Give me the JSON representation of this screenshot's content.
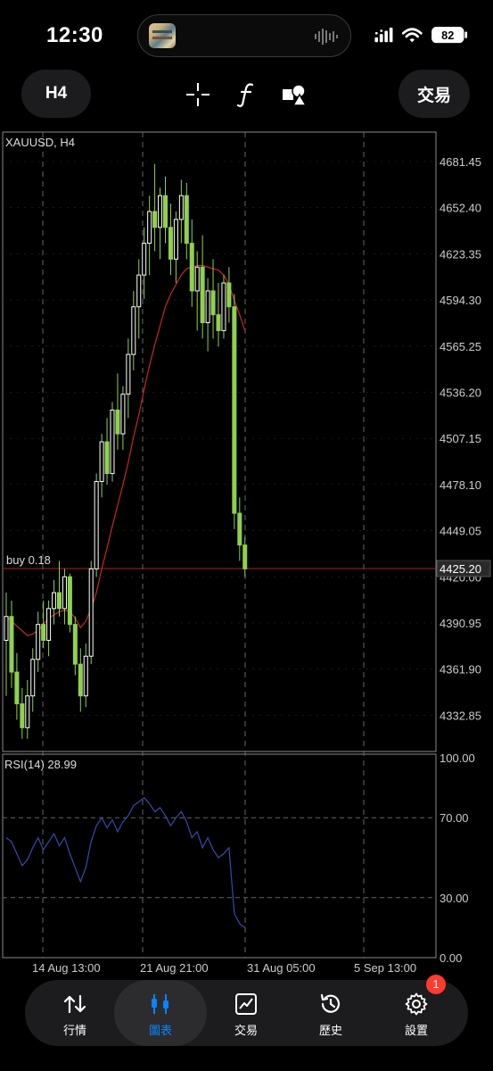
{
  "status_bar": {
    "time": "12:30",
    "battery": "82",
    "icons": [
      "signal-icon",
      "wifi-icon",
      "battery-icon"
    ]
  },
  "toolbar": {
    "timeframe_label": "H4",
    "language_label": "交易",
    "tools": [
      "crosshair-icon",
      "function-icon",
      "shapes-icon"
    ]
  },
  "chart": {
    "symbol_label": "XAUUSD, H4",
    "position_label": "buy 0.18",
    "current_price": "4425.20",
    "price_ticks": [
      "4681.45",
      "4652.40",
      "4623.35",
      "4594.30",
      "4565.25",
      "4536.20",
      "4507.15",
      "4478.10",
      "4449.05",
      "4420.00",
      "4390.95",
      "4361.90",
      "4332.85"
    ],
    "rsi_label": "RSI(14) 28.99",
    "rsi_ticks": [
      "100.00",
      "70.00",
      "30.00",
      "0.00"
    ],
    "date_ticks": [
      "14 Aug 13:00",
      "21 Aug 21:00",
      "31 Aug 05:00",
      "5 Sep 13:00"
    ],
    "colors": {
      "bull": "#ffffff",
      "bear": "#8fd14f",
      "ma": "#c62828",
      "rsi": "#3949ab",
      "price_line": "#b71c1c",
      "grid": "#666666"
    }
  },
  "chart_data": {
    "type": "candlestick",
    "title": "XAUUSD, H4",
    "ylim": [
      4310,
      4700
    ],
    "ohlc": [
      [
        4380,
        4410,
        4345,
        4395
      ],
      [
        4395,
        4405,
        4350,
        4360
      ],
      [
        4360,
        4372,
        4330,
        4340
      ],
      [
        4340,
        4350,
        4318,
        4325
      ],
      [
        4325,
        4355,
        4318,
        4345
      ],
      [
        4345,
        4375,
        4335,
        4368
      ],
      [
        4368,
        4398,
        4360,
        4390
      ],
      [
        4390,
        4405,
        4375,
        4380
      ],
      [
        4380,
        4405,
        4370,
        4400
      ],
      [
        4400,
        4418,
        4390,
        4410
      ],
      [
        4410,
        4430,
        4395,
        4400
      ],
      [
        4400,
        4425,
        4390,
        4420
      ],
      [
        4420,
        4422,
        4385,
        4390
      ],
      [
        4390,
        4395,
        4358,
        4365
      ],
      [
        4365,
        4375,
        4335,
        4345
      ],
      [
        4345,
        4378,
        4338,
        4370
      ],
      [
        4370,
        4430,
        4365,
        4425
      ],
      [
        4425,
        4485,
        4420,
        4480
      ],
      [
        4480,
        4510,
        4470,
        4505
      ],
      [
        4505,
        4520,
        4478,
        4485
      ],
      [
        4485,
        4530,
        4480,
        4525
      ],
      [
        4525,
        4548,
        4500,
        4510
      ],
      [
        4510,
        4540,
        4500,
        4535
      ],
      [
        4535,
        4570,
        4520,
        4560
      ],
      [
        4560,
        4600,
        4550,
        4590
      ],
      [
        4590,
        4620,
        4570,
        4610
      ],
      [
        4610,
        4640,
        4595,
        4630
      ],
      [
        4630,
        4660,
        4610,
        4650
      ],
      [
        4650,
        4680,
        4625,
        4640
      ],
      [
        4640,
        4665,
        4620,
        4660
      ],
      [
        4660,
        4672,
        4630,
        4640
      ],
      [
        4640,
        4655,
        4610,
        4620
      ],
      [
        4620,
        4650,
        4605,
        4645
      ],
      [
        4645,
        4670,
        4630,
        4660
      ],
      [
        4660,
        4668,
        4620,
        4630
      ],
      [
        4630,
        4645,
        4590,
        4600
      ],
      [
        4600,
        4625,
        4575,
        4615
      ],
      [
        4615,
        4635,
        4570,
        4580
      ],
      [
        4580,
        4608,
        4562,
        4600
      ],
      [
        4600,
        4620,
        4570,
        4585
      ],
      [
        4585,
        4605,
        4565,
        4575
      ],
      [
        4575,
        4610,
        4570,
        4605
      ],
      [
        4605,
        4615,
        4580,
        4590
      ],
      [
        4590,
        4598,
        4450,
        4460
      ],
      [
        4460,
        4470,
        4430,
        4440
      ],
      [
        4440,
        4445,
        4420,
        4425
      ]
    ],
    "ma": [
      4395,
      4392,
      4389,
      4386,
      4383,
      4384,
      4386,
      4390,
      4394,
      4396,
      4398,
      4399,
      4398,
      4394,
      4388,
      4392,
      4400,
      4410,
      4425,
      4438,
      4452,
      4465,
      4478,
      4492,
      4508,
      4522,
      4538,
      4553,
      4566,
      4578,
      4590,
      4598,
      4604,
      4610,
      4614,
      4615,
      4616,
      4616,
      4615,
      4614,
      4613,
      4610,
      4604,
      4594,
      4585,
      4575
    ],
    "rsi": [
      60,
      58,
      52,
      46,
      49,
      55,
      60,
      54,
      58,
      62,
      56,
      60,
      52,
      45,
      38,
      45,
      58,
      66,
      70,
      65,
      69,
      63,
      68,
      71,
      76,
      78,
      80,
      77,
      73,
      75,
      71,
      66,
      70,
      73,
      68,
      60,
      63,
      55,
      60,
      54,
      50,
      52,
      55,
      22,
      17,
      15
    ]
  },
  "tabbar": {
    "tabs": [
      {
        "label": "行情",
        "icon": "quotes-icon"
      },
      {
        "label": "圖表",
        "icon": "chart-icon"
      },
      {
        "label": "交易",
        "icon": "trade-icon"
      },
      {
        "label": "歷史",
        "icon": "history-icon"
      },
      {
        "label": "設置",
        "icon": "settings-icon"
      }
    ],
    "settings_badge": "1"
  }
}
